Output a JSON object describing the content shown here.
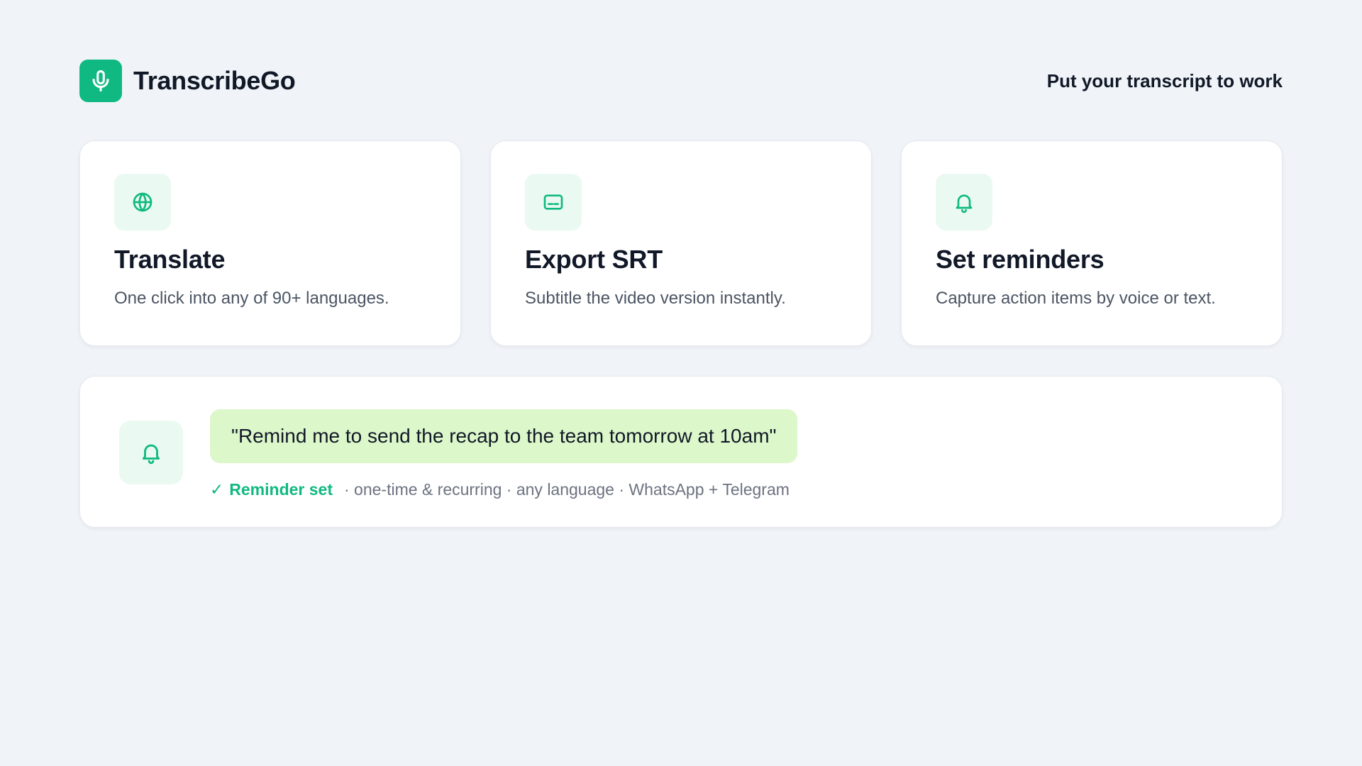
{
  "brand": {
    "name": "TranscribeGo",
    "logo_icon": "microphone-icon",
    "accent_color": "#10b981"
  },
  "header": {
    "tagline": "Put your transcript to work"
  },
  "features": [
    {
      "icon": "globe-icon",
      "title": "Translate",
      "description": "One click into any of 90+ languages."
    },
    {
      "icon": "subtitles-icon",
      "title": "Export SRT",
      "description": "Subtitle the video version instantly."
    },
    {
      "icon": "bell-icon",
      "title": "Set reminders",
      "description": "Capture action items by voice or text."
    }
  ],
  "reminder": {
    "icon": "bell-icon",
    "quote": "\"Remind me to send the recap to the team tomorrow at 10am\"",
    "status_check": "✓",
    "status": "Reminder set",
    "details": "· one-time & recurring · any language · WhatsApp + Telegram",
    "bubble_color": "#dcf7c9"
  }
}
